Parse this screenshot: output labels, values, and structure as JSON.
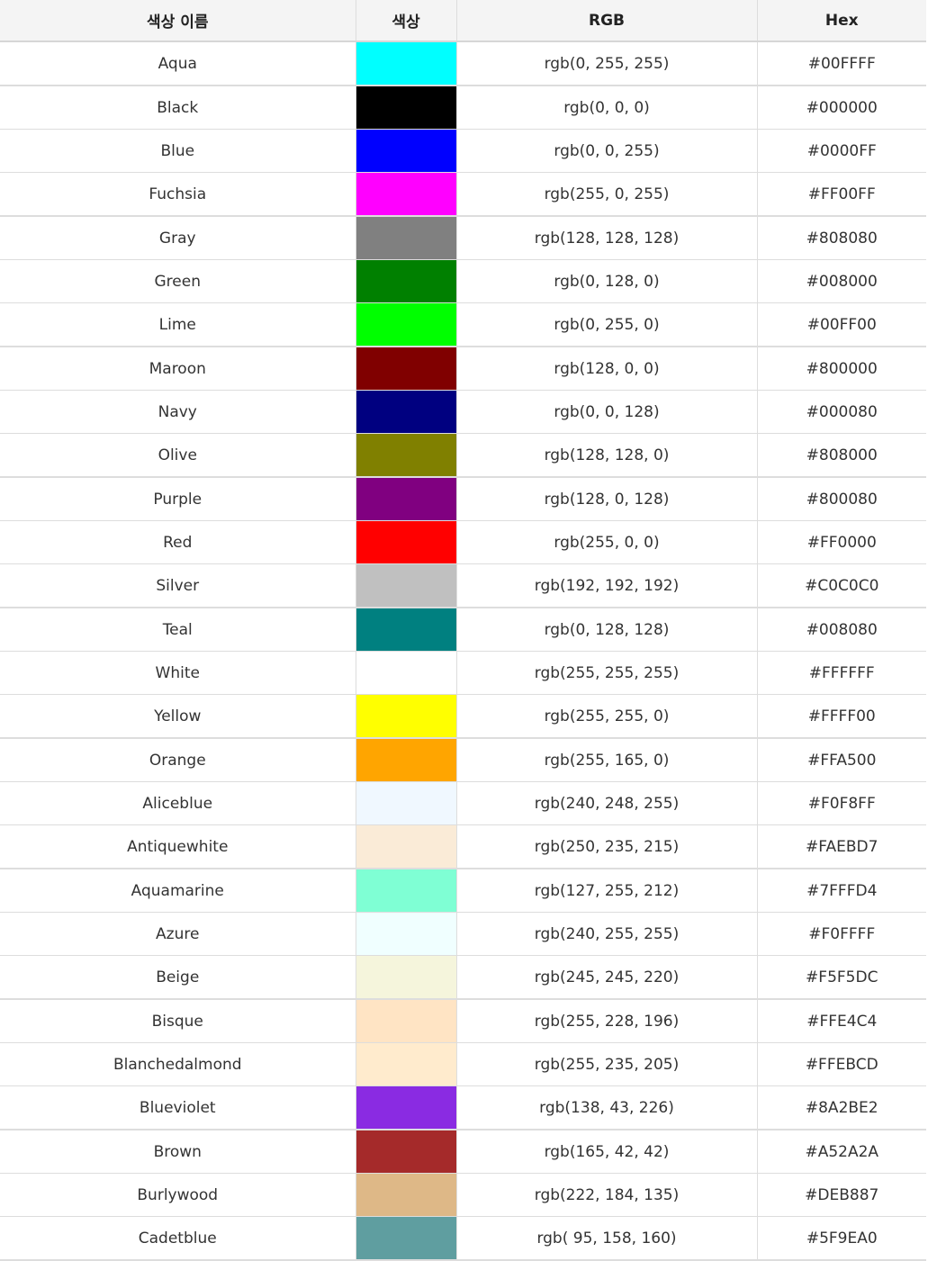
{
  "table": {
    "headers": {
      "name": "색상 이름",
      "swatch": "색상",
      "rgb": "RGB",
      "hex": "Hex"
    },
    "rows": [
      {
        "name": "Aqua",
        "rgb": "rgb(0, 255, 255)",
        "hex": "#00FFFF",
        "color": "#00FFFF"
      },
      {
        "name": "Black",
        "rgb": "rgb(0, 0, 0)",
        "hex": "#000000",
        "color": "#000000"
      },
      {
        "name": "Blue",
        "rgb": "rgb(0, 0, 255)",
        "hex": "#0000FF",
        "color": "#0000FF"
      },
      {
        "name": "Fuchsia",
        "rgb": "rgb(255, 0, 255)",
        "hex": "#FF00FF",
        "color": "#FF00FF"
      },
      {
        "name": "Gray",
        "rgb": "rgb(128, 128, 128)",
        "hex": "#808080",
        "color": "#808080"
      },
      {
        "name": "Green",
        "rgb": "rgb(0, 128, 0)",
        "hex": "#008000",
        "color": "#008000"
      },
      {
        "name": "Lime",
        "rgb": "rgb(0, 255, 0)",
        "hex": "#00FF00",
        "color": "#00FF00"
      },
      {
        "name": "Maroon",
        "rgb": "rgb(128, 0, 0)",
        "hex": "#800000",
        "color": "#800000"
      },
      {
        "name": "Navy",
        "rgb": "rgb(0, 0, 128)",
        "hex": "#000080",
        "color": "#000080"
      },
      {
        "name": "Olive",
        "rgb": "rgb(128, 128, 0)",
        "hex": "#808000",
        "color": "#808000"
      },
      {
        "name": "Purple",
        "rgb": "rgb(128, 0, 128)",
        "hex": "#800080",
        "color": "#800080"
      },
      {
        "name": "Red",
        "rgb": "rgb(255, 0, 0)",
        "hex": "#FF0000",
        "color": "#FF0000"
      },
      {
        "name": "Silver",
        "rgb": "rgb(192, 192, 192)",
        "hex": "#C0C0C0",
        "color": "#C0C0C0"
      },
      {
        "name": "Teal",
        "rgb": "rgb(0, 128, 128)",
        "hex": "#008080",
        "color": "#008080"
      },
      {
        "name": "White",
        "rgb": "rgb(255, 255, 255)",
        "hex": "#FFFFFF",
        "color": "#FFFFFF"
      },
      {
        "name": "Yellow",
        "rgb": "rgb(255, 255, 0)",
        "hex": "#FFFF00",
        "color": "#FFFF00"
      },
      {
        "name": "Orange",
        "rgb": "rgb(255, 165, 0)",
        "hex": "#FFA500",
        "color": "#FFA500"
      },
      {
        "name": "Aliceblue",
        "rgb": "rgb(240, 248, 255)",
        "hex": "#F0F8FF",
        "color": "#F0F8FF"
      },
      {
        "name": "Antiquewhite",
        "rgb": "rgb(250, 235, 215)",
        "hex": "#FAEBD7",
        "color": "#FAEBD7"
      },
      {
        "name": "Aquamarine",
        "rgb": "rgb(127, 255, 212)",
        "hex": "#7FFFD4",
        "color": "#7FFFD4"
      },
      {
        "name": "Azure",
        "rgb": "rgb(240, 255, 255)",
        "hex": "#F0FFFF",
        "color": "#F0FFFF"
      },
      {
        "name": "Beige",
        "rgb": "rgb(245, 245, 220)",
        "hex": "#F5F5DC",
        "color": "#F5F5DC"
      },
      {
        "name": "Bisque",
        "rgb": "rgb(255, 228, 196)",
        "hex": "#FFE4C4",
        "color": "#FFE4C4"
      },
      {
        "name": "Blanchedalmond",
        "rgb": "rgb(255, 235, 205)",
        "hex": "#FFEBCD",
        "color": "#FFEBCD"
      },
      {
        "name": "Blueviolet",
        "rgb": "rgb(138, 43, 226)",
        "hex": "#8A2BE2",
        "color": "#8A2BE2"
      },
      {
        "name": "Brown",
        "rgb": "rgb(165, 42, 42)",
        "hex": "#A52A2A",
        "color": "#A52A2A"
      },
      {
        "name": "Burlywood",
        "rgb": "rgb(222, 184, 135)",
        "hex": "#DEB887",
        "color": "#DEB887"
      },
      {
        "name": "Cadetblue",
        "rgb": "rgb( 95, 158, 160)",
        "hex": "#5F9EA0",
        "color": "#5F9EA0"
      }
    ]
  }
}
